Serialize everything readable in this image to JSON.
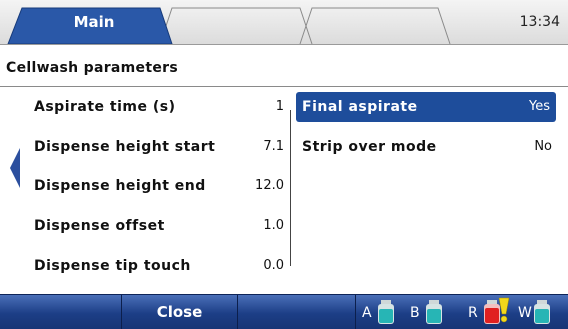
{
  "header": {
    "tabs": [
      {
        "label": "Main",
        "active": true
      },
      {
        "label": "",
        "active": false
      },
      {
        "label": "",
        "active": false
      }
    ],
    "clock": "13:34"
  },
  "section": {
    "title": "Cellwash parameters"
  },
  "left_params": [
    {
      "label": "Aspirate time (s)",
      "value": "1"
    },
    {
      "label": "Dispense height start",
      "value": "7.1"
    },
    {
      "label": "Dispense height end",
      "value": "12.0"
    },
    {
      "label": "Dispense offset",
      "value": "1.0"
    },
    {
      "label": "Dispense tip touch",
      "value": "0.0"
    }
  ],
  "right_params": [
    {
      "label": "Final aspirate",
      "value": "Yes",
      "selected": true
    },
    {
      "label": "Strip over mode",
      "value": "No",
      "selected": false
    }
  ],
  "footer": {
    "softkeys": [
      "",
      "Close",
      ""
    ],
    "bottles": [
      {
        "letter": "A",
        "color": "#27b5b5",
        "warning": false
      },
      {
        "letter": "B",
        "color": "#27b5b5",
        "warning": false
      },
      {
        "letter": "R",
        "color": "#e02020",
        "warning": true
      },
      {
        "letter": "W",
        "color": "#27b5b5",
        "warning": false
      }
    ]
  },
  "colors": {
    "accent": "#1e4d9b",
    "footer": "#1c3e86",
    "warning": "#f2d81c"
  }
}
